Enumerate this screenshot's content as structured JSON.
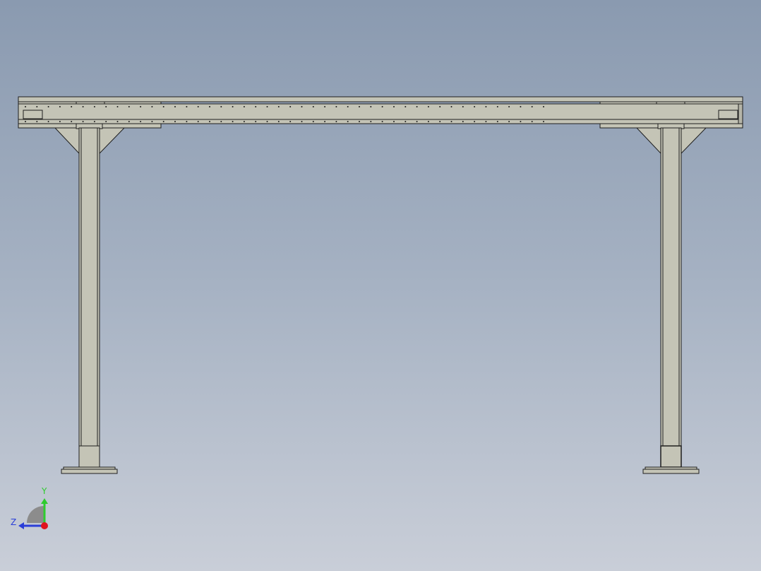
{
  "view": {
    "background_top": "#8a9ab0",
    "background_bottom": "#c9ced8"
  },
  "model": {
    "name": "conveyor-frame",
    "face_color": "#c4c4b6",
    "edge_color": "#1e1e1e",
    "legs": 2,
    "rail_hole_count": 46
  },
  "triad": {
    "y_label": "Y",
    "z_label": "Z",
    "y_color": "#2ecc2e",
    "z_color": "#2a3ed8",
    "x_color": "#e0141e"
  }
}
